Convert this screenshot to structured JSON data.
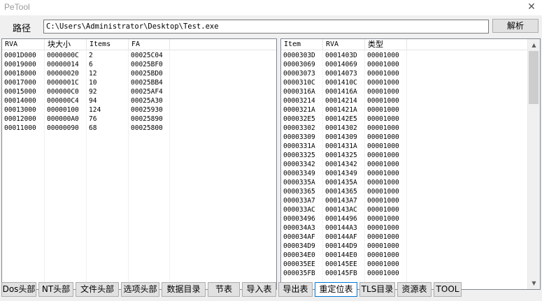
{
  "window": {
    "title": "PeTool",
    "close_glyph": "✕"
  },
  "path": {
    "label": "路径",
    "value": "C:\\Users\\Administrator\\Desktop\\Test.exe"
  },
  "analyze_button": "解析",
  "left_table": {
    "columns": [
      "RVA",
      "块大小",
      "Items",
      "FA"
    ],
    "rows": [
      [
        "0001D000",
        "0000000C",
        "2",
        "00025C04"
      ],
      [
        "00019000",
        "00000014",
        "6",
        "00025BF0"
      ],
      [
        "00018000",
        "00000020",
        "12",
        "00025BD0"
      ],
      [
        "00017000",
        "0000001C",
        "10",
        "00025BB4"
      ],
      [
        "00015000",
        "000000C0",
        "92",
        "00025AF4"
      ],
      [
        "00014000",
        "000000C4",
        "94",
        "00025A30"
      ],
      [
        "00013000",
        "00000100",
        "124",
        "00025930"
      ],
      [
        "00012000",
        "000000A0",
        "76",
        "00025890"
      ],
      [
        "00011000",
        "00000090",
        "68",
        "00025800"
      ]
    ]
  },
  "right_table": {
    "columns": [
      "Item",
      "RVA",
      "类型"
    ],
    "rows": [
      [
        "0000303D",
        "0001403D",
        "00001000"
      ],
      [
        "00003069",
        "00014069",
        "00001000"
      ],
      [
        "00003073",
        "00014073",
        "00001000"
      ],
      [
        "0000310C",
        "0001410C",
        "00001000"
      ],
      [
        "0000316A",
        "0001416A",
        "00001000"
      ],
      [
        "00003214",
        "00014214",
        "00001000"
      ],
      [
        "0000321A",
        "0001421A",
        "00001000"
      ],
      [
        "000032E5",
        "000142E5",
        "00001000"
      ],
      [
        "00003302",
        "00014302",
        "00001000"
      ],
      [
        "00003309",
        "00014309",
        "00001000"
      ],
      [
        "0000331A",
        "0001431A",
        "00001000"
      ],
      [
        "00003325",
        "00014325",
        "00001000"
      ],
      [
        "00003342",
        "00014342",
        "00001000"
      ],
      [
        "00003349",
        "00014349",
        "00001000"
      ],
      [
        "0000335A",
        "0001435A",
        "00001000"
      ],
      [
        "00003365",
        "00014365",
        "00001000"
      ],
      [
        "000033A7",
        "000143A7",
        "00001000"
      ],
      [
        "000033AC",
        "000143AC",
        "00001000"
      ],
      [
        "00003496",
        "00014496",
        "00001000"
      ],
      [
        "000034A3",
        "000144A3",
        "00001000"
      ],
      [
        "000034AF",
        "000144AF",
        "00001000"
      ],
      [
        "000034D9",
        "000144D9",
        "00001000"
      ],
      [
        "000034E0",
        "000144E0",
        "00001000"
      ],
      [
        "000035EE",
        "000145EE",
        "00001000"
      ],
      [
        "000035FB",
        "000145FB",
        "00001000"
      ]
    ],
    "scroll_up_glyph": "▲",
    "scroll_down_glyph": "▼"
  },
  "tabs": [
    {
      "label": "Dos头部",
      "active": false
    },
    {
      "label": "NT头部",
      "active": false
    },
    {
      "label": "文件头部",
      "active": false
    },
    {
      "label": "选项头部",
      "active": false
    },
    {
      "label": "数据目录",
      "active": false
    },
    {
      "label": "节表",
      "active": false
    },
    {
      "label": "导入表",
      "active": false
    },
    {
      "label": "导出表",
      "active": false
    },
    {
      "label": "重定位表",
      "active": true
    },
    {
      "label": "TLS目录",
      "active": false
    },
    {
      "label": "资源表",
      "active": false
    },
    {
      "label": "TOOL",
      "active": false
    }
  ]
}
